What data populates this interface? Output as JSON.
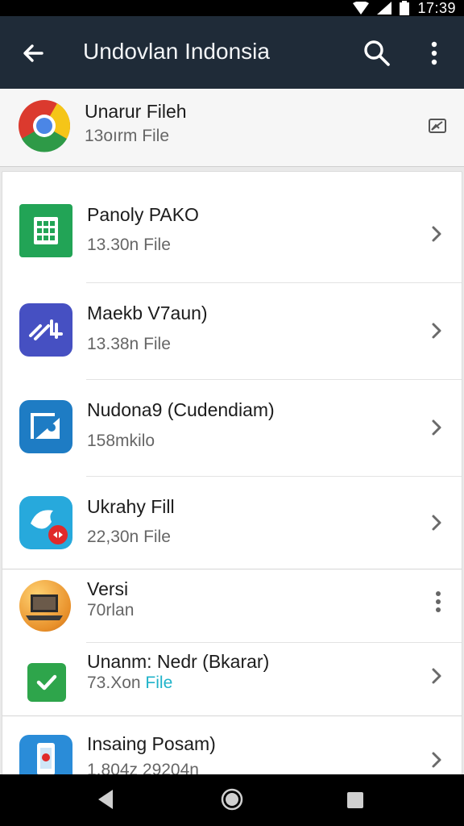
{
  "status_bar": {
    "time": "17:39"
  },
  "app_bar": {
    "title": "Undovlan Indonsia"
  },
  "pinned_item": {
    "name": "Unarur Fileh",
    "size": "13oırm File"
  },
  "items": [
    {
      "name": "Panoly PAKO",
      "size": "13.30n File"
    },
    {
      "name": "Maekb V7aun)",
      "size": "13.38n File"
    },
    {
      "name": "Nudona9 (Cudendiam)",
      "size": "158mkilo"
    },
    {
      "name": "Ukrahy Fill",
      "size": "22,30n File"
    },
    {
      "name": "Versi",
      "size": "70rlan"
    },
    {
      "name": "Unanm: Nedr (Bkarar)",
      "size_prefix": "73.Xon",
      "size_suffix": "File"
    },
    {
      "name": "Insaing Posam)",
      "size": "1.804z 29204n"
    }
  ],
  "colors": {
    "app_bar": "#1f2b38",
    "link_accent": "#1fb3c9"
  }
}
